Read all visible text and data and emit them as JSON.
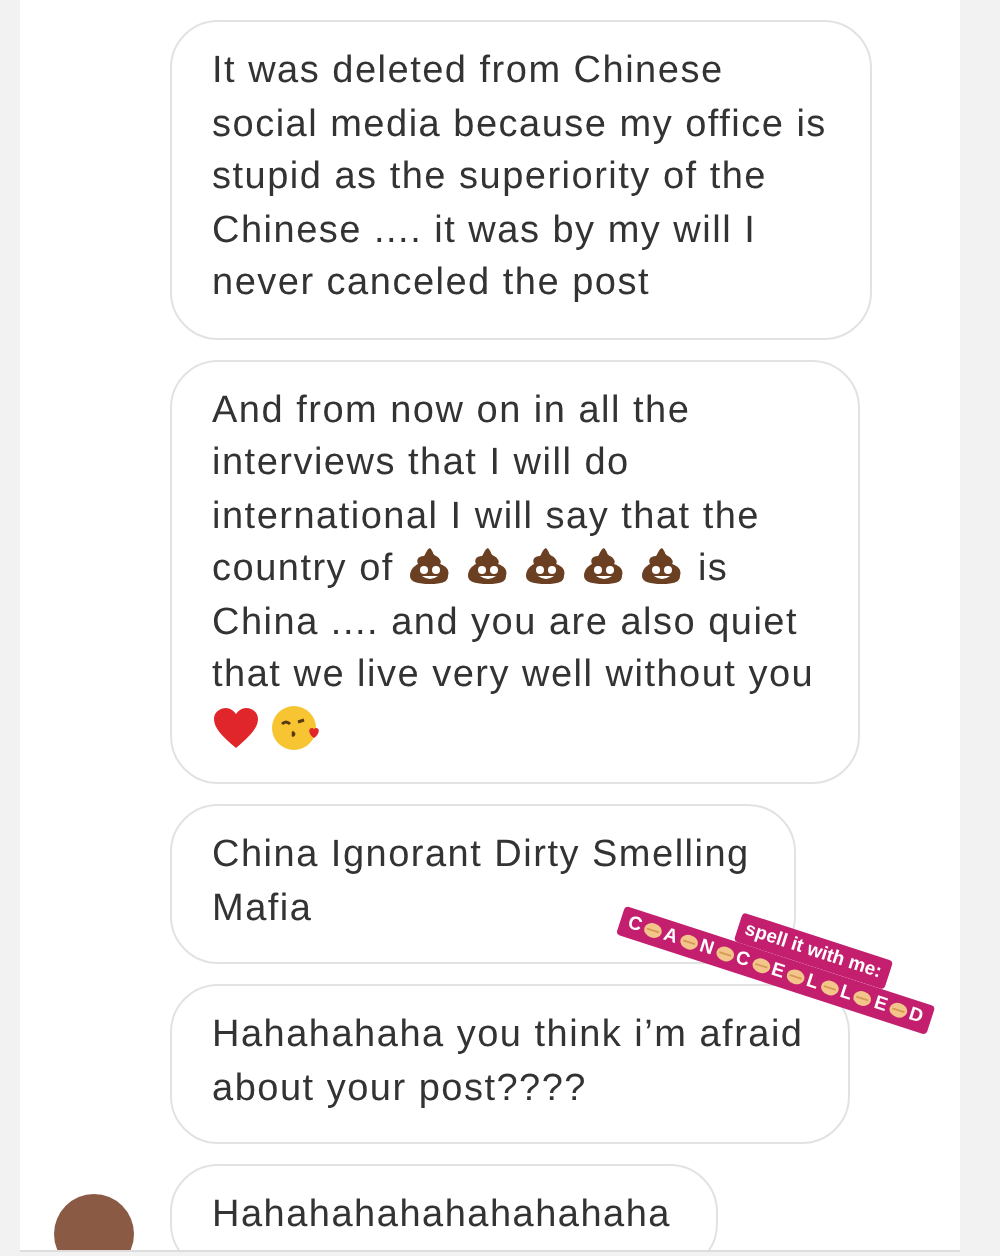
{
  "messages": [
    {
      "avatar": false,
      "lines": [
        [
          {
            "kind": "text",
            "text": "It was deleted from Chinese"
          }
        ],
        [
          {
            "kind": "text",
            "text": "social media because my office is"
          }
        ],
        [
          {
            "kind": "text",
            "text": "stupid as the superiority of the"
          }
        ],
        [
          {
            "kind": "text",
            "text": "Chinese .... it was by my will I"
          }
        ],
        [
          {
            "kind": "text",
            "text": "never canceled the post"
          }
        ]
      ]
    },
    {
      "avatar": false,
      "lines": [
        [
          {
            "kind": "text",
            "text": "And from now on in all the"
          }
        ],
        [
          {
            "kind": "text",
            "text": "interviews that I will do"
          }
        ],
        [
          {
            "kind": "text",
            "text": "international I will say that the"
          }
        ],
        [
          {
            "kind": "text",
            "text": "country of"
          },
          {
            "kind": "poop"
          },
          {
            "kind": "poop"
          },
          {
            "kind": "poop"
          },
          {
            "kind": "poop"
          },
          {
            "kind": "poop"
          },
          {
            "kind": "text",
            "text": "is"
          }
        ],
        [
          {
            "kind": "text",
            "text": "China .... and you are also quiet"
          }
        ],
        [
          {
            "kind": "text",
            "text": "that we live very well without you"
          }
        ],
        [
          {
            "kind": "heart"
          },
          {
            "kind": "kiss"
          }
        ]
      ]
    },
    {
      "avatar": false,
      "lines": [
        [
          {
            "kind": "text",
            "text": "China Ignorant Dirty Smelling"
          }
        ],
        [
          {
            "kind": "text",
            "text": "Mafia"
          }
        ]
      ]
    },
    {
      "avatar": false,
      "lines": [
        [
          {
            "kind": "text",
            "text": "Hahahahaha you think i’m afraid"
          }
        ],
        [
          {
            "kind": "text",
            "text": "about your post????"
          }
        ]
      ]
    },
    {
      "avatar": true,
      "lines": [
        [
          {
            "kind": "text",
            "text": "Hahahahahahahahahaha"
          }
        ]
      ]
    }
  ],
  "sticker": {
    "title": "spell it with me:",
    "letters": [
      "C",
      "A",
      "N",
      "C",
      "E",
      "L",
      "L",
      "E",
      "D"
    ]
  }
}
